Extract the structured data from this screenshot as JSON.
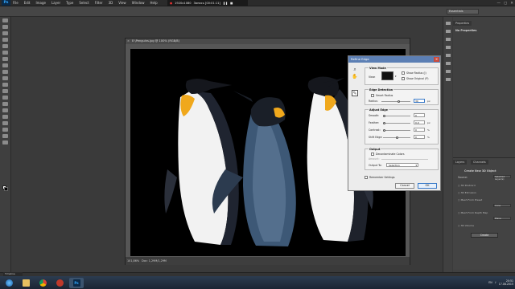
{
  "app": {
    "logo": "Ps",
    "menu": [
      "File",
      "Edit",
      "Image",
      "Layer",
      "Type",
      "Select",
      "Filter",
      "3D",
      "View",
      "Window",
      "Help"
    ]
  },
  "recorder": {
    "resolution": "1920x1080",
    "status": "Запись [00:01:11]"
  },
  "window_controls": [
    "—",
    "▢",
    "✕"
  ],
  "options_bar": {
    "workspace": "Essentials"
  },
  "document": {
    "title": "E:\\Penguins.jpg @ 100% (RGB/8)",
    "zoom": "101,86%",
    "info": "Doc: 1,29M/1,29M"
  },
  "dialog": {
    "title": "Refine Edge",
    "view_mode": {
      "title": "View Mode",
      "view_label": "View:",
      "show_radius": "Show Radius (J)",
      "show_original": "Show Original (P)"
    },
    "edge_detection": {
      "title": "Edge Detection",
      "smart_radius": "Smart Radius",
      "radius_label": "Radius:",
      "radius_value": "30",
      "radius_unit": "px",
      "radius_pct": 0.6
    },
    "adjust_edge": {
      "title": "Adjust Edge",
      "rows": [
        {
          "label": "Smooth:",
          "value": "0",
          "unit": "",
          "pct": 0.0
        },
        {
          "label": "Feather:",
          "value": "0,0",
          "unit": "px",
          "pct": 0.0
        },
        {
          "label": "Contrast:",
          "value": "0",
          "unit": "%",
          "pct": 0.0
        },
        {
          "label": "Shift Edge:",
          "value": "0",
          "unit": "%",
          "pct": 0.5
        }
      ]
    },
    "output": {
      "title": "Output",
      "decontaminate": "Decontaminate Colors",
      "amount_label": "Amount:",
      "output_to_label": "Output To:",
      "output_to_value": "Selection"
    },
    "remember": "Remember Settings",
    "cancel": "Cancel",
    "ok": "OK"
  },
  "right_panel": {
    "tabs": [
      "Properties"
    ],
    "properties_title": "No Properties",
    "tabs_3d": [
      "Layers",
      "Channels"
    ],
    "create_title": "Create New 3D Object",
    "source_label": "Source:",
    "source_value": "Selected Layer(s)",
    "options": [
      "3D Postcard",
      "3D Extrusion",
      "Mesh From Preset",
      "Mesh From Depth Map",
      "3D Volume"
    ],
    "preset_value": "Cone",
    "depth_value": "Plane",
    "create_button": "Create"
  },
  "timeline": {
    "label": "Timeline"
  },
  "taskbar": {
    "icons": [
      "start-orb-icon",
      "explorer-icon",
      "chrome-icon",
      "recorder-icon",
      "photoshop-icon"
    ]
  },
  "clock": {
    "time": "20:51",
    "date": "17.08.2015",
    "lang": "EN"
  }
}
